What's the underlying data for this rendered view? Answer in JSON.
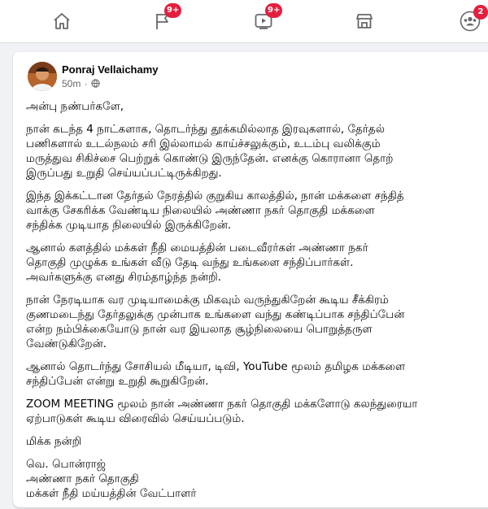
{
  "nav": {
    "items": [
      {
        "name": "home"
      },
      {
        "name": "pages",
        "badge": "9+"
      },
      {
        "name": "watch",
        "badge": "9+"
      },
      {
        "name": "marketplace"
      },
      {
        "name": "groups",
        "badge": "2"
      }
    ],
    "active_color": "#1877f2",
    "icon_color": "#65676b",
    "badge_color": "#e41e3f"
  },
  "post": {
    "author": "Ponraj Vellaichamy",
    "time": "50m",
    "privacy_icon": "globe-icon",
    "paragraphs": [
      [
        "அன்பு நண்பர்களே,"
      ],
      [
        "நான் கடந்த 4 நாட்களாக, தொடர்ந்து தூக்கமில்லாத இரவுகளால், தேர்தல்",
        "பணிகளால் உடல்நலம் சரி இல்லாமல் காய்ச்சலுக்கும், உடம்பு வலிக்கும்",
        "மருத்துவ சிகிச்சை பெற்றுக் கொண்டு இருந்தேன். எனக்கு கொரானா தொற்",
        "இருப்பது உறுதி செய்யப்பட்டிருக்கிறது."
      ],
      [
        "இந்த இக்கட்டான தேர்தல் நேரத்தில் குறுகிய காலத்தில், நான் மக்களை சந்தித்",
        "வாக்கு சேகரிக்க வேண்டிய நிலையில் அண்ணா நகர் தொகுதி மக்களை",
        "சந்திக்க முடியாத நிலையில் இருக்கிறேன்."
      ],
      [
        "ஆனால் களத்தில் மக்கள் நீதி மையத்தின்  படைவீரர்கள் அண்ணா நகர்",
        "தொகுதி முழுக்க உங்கள் வீடு தேடி வந்து உங்களை சந்திப்பார்கள்.",
        "அவர்களுக்கு எனது சிரம்தாழ்ந்த நன்றி."
      ],
      [
        "நான் நேரடியாக வர முடியாமைக்கு மிகவும் வருந்துகிறேன் கூடிய சீக்கிரம்",
        "குணமடைந்து தேர்தலுக்கு முன்பாக உங்களை வந்து கண்டிப்பாக சந்திப்பேன்",
        "என்ற நம்பிக்கையோடு நான் வர இயலாத சூழ்நிலையை பொறுத்தருள",
        "வேண்டுகிறேன்."
      ],
      [
        "ஆனால் தொடர்ந்து சோசியல் மீடியா, டிவி, YouTube மூலம் தமிழக மக்களை",
        "சந்திப்பேன் என்று உறுதி கூறுகிறேன்."
      ],
      [
        "ZOOM MEETING மூலம் நான் அண்ணா நகர் தொகுதி மக்களோடு கலந்துரையா",
        "ஏற்பாடுகள் கூடிய விரைவில் செய்யப்படும்."
      ],
      [
        "மிக்க நன்றி"
      ],
      [
        "வெ. பொன்ராஜ்",
        "அண்ணா நகர் தொகுதி",
        "மக்கள் நீதி மய்யத்தின் வேட்பாளர்"
      ]
    ]
  }
}
